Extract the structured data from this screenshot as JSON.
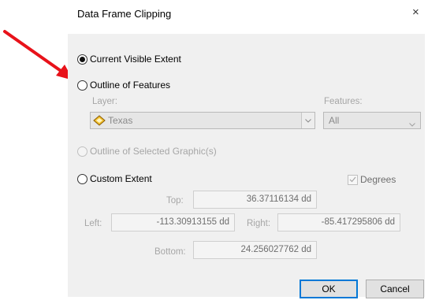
{
  "dialog": {
    "title": "Data Frame Clipping",
    "close_glyph": "×"
  },
  "options": {
    "current_visible_extent": "Current Visible Extent",
    "outline_of_features": "Outline of Features",
    "outline_of_selected_graphics": "Outline of Selected Graphic(s)",
    "custom_extent": "Custom Extent"
  },
  "layer": {
    "label": "Layer:",
    "value": "Texas"
  },
  "features": {
    "label": "Features:",
    "value": "All"
  },
  "degrees": {
    "label": "Degrees",
    "checked": true
  },
  "extent": {
    "top_label": "Top:",
    "top_value": "36.37116134 dd",
    "left_label": "Left:",
    "left_value": "-113.30913155 dd",
    "right_label": "Right:",
    "right_value": "-85.417295806 dd",
    "bottom_label": "Bottom:",
    "bottom_value": "24.256027762 dd"
  },
  "buttons": {
    "ok": "OK",
    "cancel": "Cancel"
  },
  "icons": {
    "annotation": "red-arrow-icon",
    "layer": "layer-diamond-icon",
    "close": "close-icon"
  },
  "colors": {
    "annotation_arrow": "#e8121a",
    "ok_border": "#0078d7",
    "panel_bg": "#f0f0f0"
  }
}
